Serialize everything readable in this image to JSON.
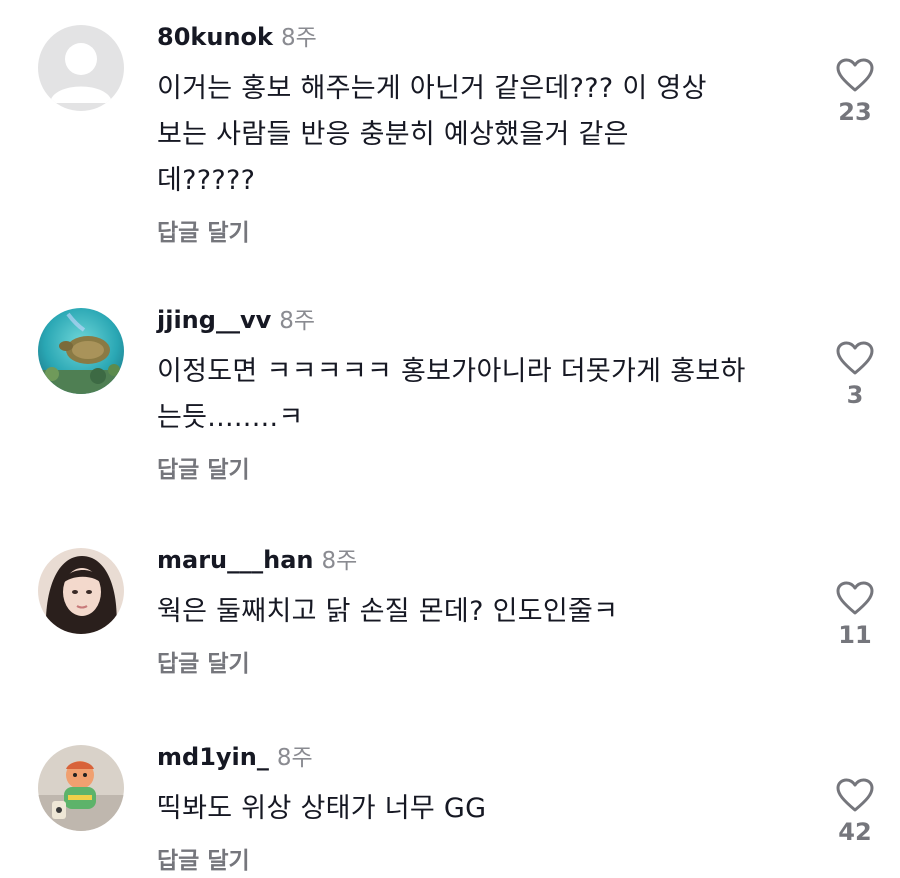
{
  "comments": [
    {
      "username": "80kunok",
      "time": "8주",
      "text": "이거는 홍보 해주는게 아닌거 같은데??? 이 영상보는 사람들 반응 충분히 예상했을거 같은데?????",
      "reply_label": "답글 달기",
      "likes": "23",
      "avatar": "default-avatar-icon"
    },
    {
      "username": "jjing__vv",
      "time": "8주",
      "text": "이정도면 ㅋㅋㅋㅋㅋ 홍보가아니라 더못가게 홍보하는듯........ㅋ",
      "reply_label": "답글 달기",
      "likes": "3",
      "avatar": "sea-turtle-photo"
    },
    {
      "username": "maru___han",
      "time": "8주",
      "text": "웍은 둘째치고 닭 손질 몬데? 인도인줄ㅋ",
      "reply_label": "답글 달기",
      "likes": "11",
      "avatar": "woman-portrait-photo"
    },
    {
      "username": "md1yin_",
      "time": "8주",
      "text": "띡봐도 위상 상태가 너무 GG",
      "reply_label": "답글 달기",
      "likes": "42",
      "avatar": "plush-doll-photo"
    }
  ],
  "colors": {
    "text": "#161823",
    "muted": "#8a8b91",
    "action": "#75767c",
    "heart_outline": "#75767c"
  },
  "icons": {
    "like": "heart-outline-icon"
  }
}
